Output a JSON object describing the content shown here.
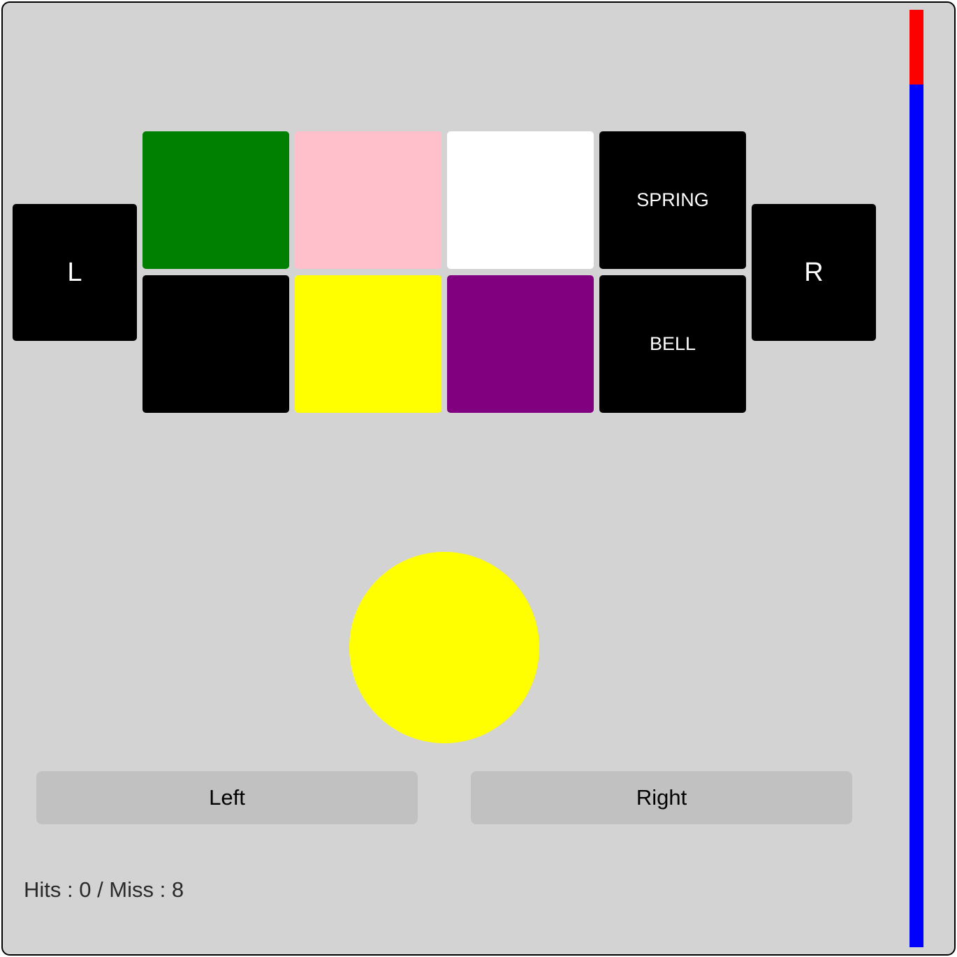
{
  "side_keys": {
    "left": "L",
    "right": "R"
  },
  "grid": {
    "top_row": [
      {
        "color": "#008000",
        "label": ""
      },
      {
        "color": "#ffc0cb",
        "label": ""
      },
      {
        "color": "#ffffff",
        "label": ""
      },
      {
        "color": "#000000",
        "label": "SPRING"
      }
    ],
    "bottom_row": [
      {
        "color": "#000000",
        "label": ""
      },
      {
        "color": "#ffff00",
        "label": ""
      },
      {
        "color": "#800080",
        "label": ""
      },
      {
        "color": "#000000",
        "label": "BELL"
      }
    ]
  },
  "stimulus": {
    "shape": "circle",
    "color": "#ffff00"
  },
  "buttons": {
    "left": "Left",
    "right": "Right"
  },
  "score": {
    "text": "Hits : 0 / Miss : 8",
    "hits": 0,
    "miss": 8
  },
  "timer": {
    "elapsed_fraction": 0.08,
    "elapsed_color": "#ff0000",
    "remaining_color": "#0000ff"
  }
}
